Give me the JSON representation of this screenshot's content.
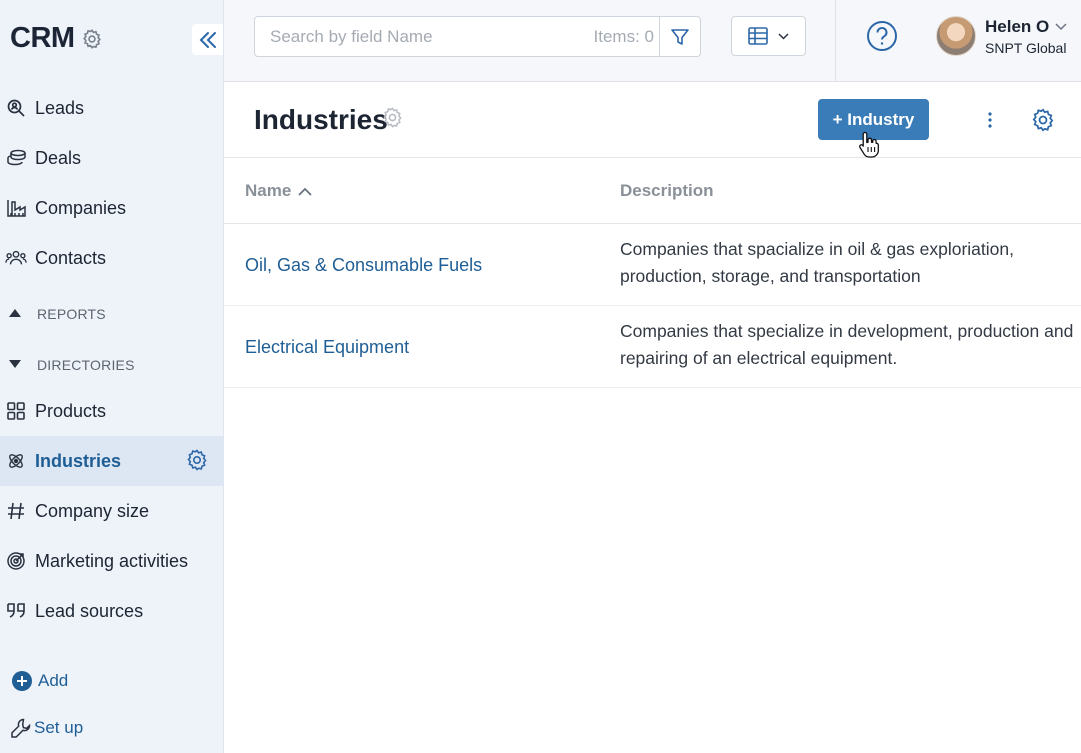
{
  "app": {
    "title": "CRM"
  },
  "sidebar": {
    "items": [
      {
        "label": "Leads",
        "icon": "search-person-icon"
      },
      {
        "label": "Deals",
        "icon": "coins-icon"
      },
      {
        "label": "Companies",
        "icon": "factory-icon"
      },
      {
        "label": "Contacts",
        "icon": "people-icon"
      }
    ],
    "reports_label": "REPORTS",
    "directories_label": "DIRECTORIES",
    "directory_items": [
      {
        "label": "Products",
        "icon": "grid-icon"
      },
      {
        "label": "Industries",
        "icon": "atom-icon",
        "active": true
      },
      {
        "label": "Company size",
        "icon": "hash-icon"
      },
      {
        "label": "Marketing activities",
        "icon": "target-icon"
      },
      {
        "label": "Lead sources",
        "icon": "quote-icon"
      }
    ],
    "add_label": "Add",
    "setup_label": "Set up"
  },
  "topbar": {
    "search_placeholder": "Search by field Name",
    "items_count": "Items: 0",
    "user": {
      "name": "Helen O",
      "org": "SNPT Global"
    }
  },
  "page": {
    "title": "Industries",
    "add_button_label": "+ Industry"
  },
  "table": {
    "columns": {
      "name": "Name",
      "description": "Description"
    },
    "rows": [
      {
        "name": "Oil, Gas & Consumable Fuels",
        "description": "Companies that spacialize in oil & gas exploriation, production, storage, and transportation"
      },
      {
        "name": "Electrical Equipment",
        "description": "Companies that specialize in development, production and repairing of an electrical equipment."
      }
    ]
  },
  "colors": {
    "accent": "#3a7cb8",
    "link": "#1f5e95",
    "sidebar_bg": "#eef3fa",
    "active_bg": "#dde6f3"
  }
}
